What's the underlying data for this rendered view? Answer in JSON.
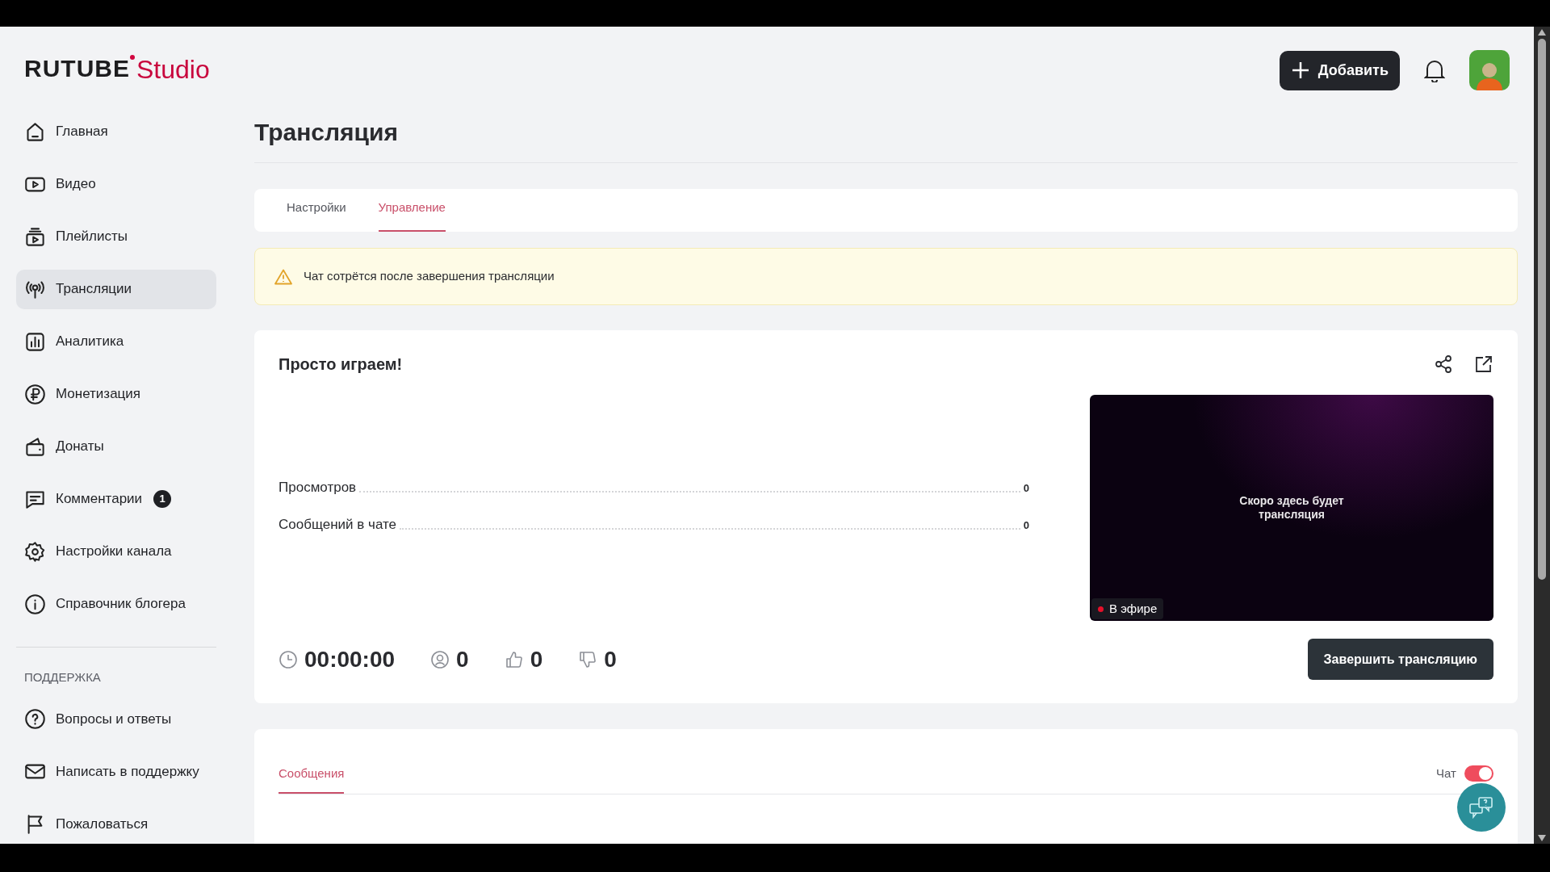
{
  "logo": {
    "brand": "RUTUBE",
    "product": "Studio"
  },
  "header": {
    "add_button": "Добавить"
  },
  "sidebar": {
    "items": [
      {
        "label": "Главная",
        "kind": "home",
        "selected": false
      },
      {
        "label": "Видео",
        "kind": "video",
        "selected": false
      },
      {
        "label": "Плейлисты",
        "kind": "playlist",
        "selected": false
      },
      {
        "label": "Трансляции",
        "kind": "broadcast",
        "selected": true
      },
      {
        "label": "Аналитика",
        "kind": "chart",
        "selected": false
      },
      {
        "label": "Монетизация",
        "kind": "ruble",
        "selected": false
      },
      {
        "label": "Донаты",
        "kind": "wallet",
        "selected": false
      },
      {
        "label": "Комментарии",
        "kind": "comment",
        "selected": false,
        "badge": "1"
      },
      {
        "label": "Настройки канала",
        "kind": "gear",
        "selected": false
      },
      {
        "label": "Справочник блогера",
        "kind": "info",
        "selected": false
      }
    ],
    "support_heading": "ПОДДЕРЖКА",
    "support_items": [
      {
        "label": "Вопросы и ответы",
        "kind": "question",
        "selected": false
      },
      {
        "label": "Написать в поддержку",
        "kind": "mail",
        "selected": false
      },
      {
        "label": "Пожаловаться",
        "kind": "flag",
        "selected": false
      }
    ]
  },
  "page_title": "Трансляция",
  "tabs": [
    {
      "label": "Настройки",
      "selected": false
    },
    {
      "label": "Управление",
      "selected": true
    }
  ],
  "alert": "Чат сотрётся после завершения трансляции",
  "stream": {
    "title": "Просто играем!",
    "stats": [
      {
        "label": "Просмотров",
        "value": "0"
      },
      {
        "label": "Сообщений в чате",
        "value": "0"
      }
    ],
    "counters": [
      {
        "kind": "clock",
        "value": "00:00:00"
      },
      {
        "kind": "viewers",
        "value": "0"
      },
      {
        "kind": "likes",
        "value": "0"
      },
      {
        "kind": "dislikes",
        "value": "0"
      }
    ],
    "preview": {
      "caption": "Скоро здесь будет трансляция",
      "live_label": "В эфире"
    },
    "end_button": "Завершить трансляцию"
  },
  "messages": {
    "tabs": [
      {
        "label": "Сообщения",
        "selected": true
      }
    ],
    "chat_toggle": {
      "label": "Чат",
      "on": true
    }
  }
}
